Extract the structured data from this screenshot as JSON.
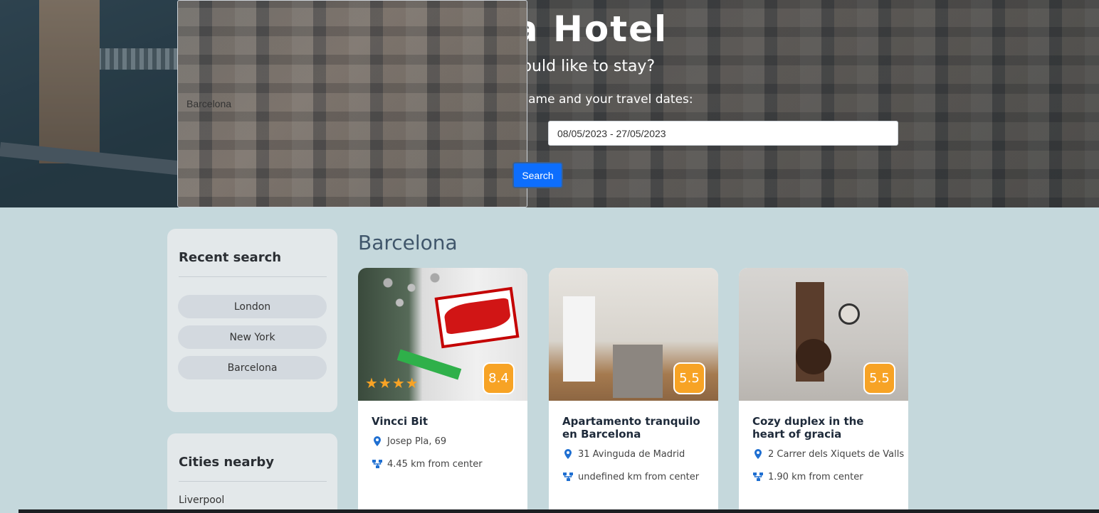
{
  "hero": {
    "title": "Find a Hotel",
    "subtitle": "Where you would like to stay?",
    "prompt": "Please enter city/town name and your travel dates:",
    "city_value": "Barcelona",
    "dates_value": "08/05/2023 - 27/05/2023",
    "search_label": "Search"
  },
  "sidebar": {
    "recent_title": "Recent search",
    "recent": [
      "London",
      "New York",
      "Barcelona"
    ],
    "nearby_title": "Cities nearby",
    "nearby": [
      "Liverpool"
    ]
  },
  "results": {
    "heading": "Barcelona",
    "hotels": [
      {
        "name": "Vincci Bit",
        "address": "Josep Pla, 69",
        "distance": "4.45 km from center",
        "rating": "8.4",
        "stars": "★★★★"
      },
      {
        "name": "Apartamento tranquilo en Barcelona",
        "address": "31 Avinguda de Madrid",
        "distance": "undefined km from center",
        "rating": "5.5",
        "stars": ""
      },
      {
        "name": "Cozy duplex in the heart of gracia",
        "address": "2 Carrer dels Xiquets de Valls",
        "distance": "1.90 km from center",
        "rating": "5.5",
        "stars": ""
      }
    ]
  },
  "colors": {
    "accent": "#0d6efd",
    "rating": "#f7a325",
    "page_bg": "#c5d8dc",
    "panel_bg": "#e3e8ea",
    "pin": "#1f6fd1"
  },
  "icons": {
    "location": "location-pin-icon",
    "distance": "route-icon",
    "star": "star-icon"
  }
}
